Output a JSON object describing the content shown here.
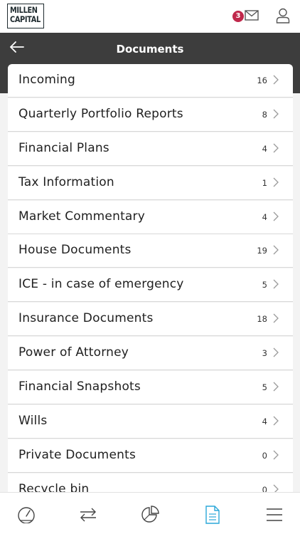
{
  "brand": {
    "logo_line1": "MILLEN",
    "logo_line2": "CAPITAL"
  },
  "topbar": {
    "unread_count": "3",
    "mail_icon": "mail-icon",
    "profile_icon": "user-icon"
  },
  "header": {
    "title": "Documents",
    "back_icon": "arrow-left-icon"
  },
  "folders": [
    {
      "label": "Incoming",
      "count": "16"
    },
    {
      "label": "Quarterly Portfolio Reports",
      "count": "8"
    },
    {
      "label": "Financial Plans",
      "count": "4"
    },
    {
      "label": "Tax Information",
      "count": "1"
    },
    {
      "label": "Market Commentary",
      "count": "4"
    },
    {
      "label": "House Documents",
      "count": "19"
    },
    {
      "label": "ICE - in case of emergency",
      "count": "5"
    },
    {
      "label": "Insurance Documents",
      "count": "18"
    },
    {
      "label": "Power of Attorney",
      "count": "3"
    },
    {
      "label": "Financial Snapshots",
      "count": "5"
    },
    {
      "label": "Wills",
      "count": "4"
    },
    {
      "label": "Private Documents",
      "count": "0"
    },
    {
      "label": "Recycle bin",
      "count": "0"
    }
  ],
  "tabs": [
    {
      "icon": "dashboard-gauge-icon",
      "active": false
    },
    {
      "icon": "transfer-arrows-icon",
      "active": false
    },
    {
      "icon": "pie-chart-icon",
      "active": false
    },
    {
      "icon": "document-icon",
      "active": true
    },
    {
      "icon": "menu-icon",
      "active": false
    }
  ],
  "colors": {
    "accent": "#2aa7d9",
    "badge": "#c0284b",
    "header": "#3d3d3d",
    "inactive_icon": "#444444"
  }
}
